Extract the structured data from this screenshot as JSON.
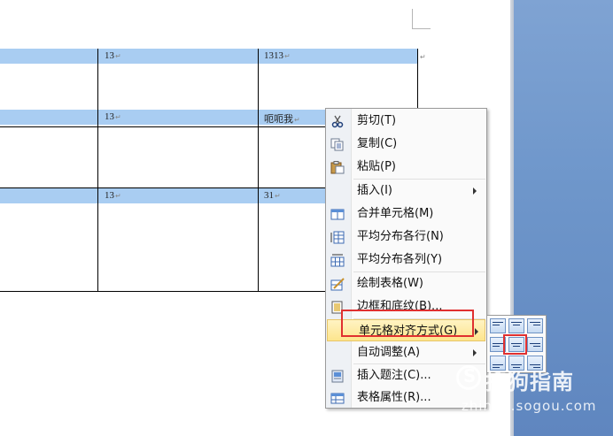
{
  "table": {
    "rows": [
      {
        "col2": "13",
        "col3": "1313"
      },
      {
        "col2": "13",
        "col3": "呃呃我"
      },
      {
        "col2": "13",
        "col3": "31"
      }
    ],
    "return_mark": "↵"
  },
  "context_menu": {
    "items": [
      {
        "label": "剪切(T)",
        "icon": "scissors-icon"
      },
      {
        "label": "复制(C)",
        "icon": "copy-icon"
      },
      {
        "label": "粘贴(P)",
        "icon": "paste-icon"
      },
      {
        "label": "插入(I)",
        "icon": "",
        "submenu": true
      },
      {
        "label": "合并单元格(M)",
        "icon": "merge-cells-icon"
      },
      {
        "label": "平均分布各行(N)",
        "icon": "distribute-rows-icon"
      },
      {
        "label": "平均分布各列(Y)",
        "icon": "distribute-columns-icon"
      },
      {
        "label": "绘制表格(W)",
        "icon": "draw-table-icon"
      },
      {
        "label": "边框和底纹(B)...",
        "icon": "borders-icon"
      },
      {
        "label": "单元格对齐方式(G)",
        "icon": "",
        "submenu": true,
        "highlighted": true
      },
      {
        "label": "自动调整(A)",
        "icon": "",
        "submenu": true
      },
      {
        "label": "插入题注(C)...",
        "icon": "caption-icon"
      },
      {
        "label": "表格属性(R)...",
        "icon": "table-properties-icon"
      }
    ]
  },
  "watermark": {
    "title": "搜狗指南",
    "url": "zhinan.sogou.com"
  },
  "colors": {
    "table_band": "#a9cdf2",
    "highlight": "#fde58d",
    "red_annotation": "#e03030",
    "desktop_blue": "#6f97cb"
  }
}
